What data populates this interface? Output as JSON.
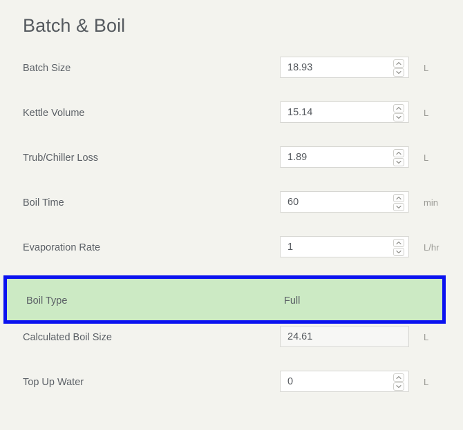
{
  "header": {
    "title": "Batch & Boil"
  },
  "form": {
    "rows": [
      {
        "label": "Batch Size",
        "value": "18.93",
        "unit": "L",
        "type": "spinner",
        "name": "batch-size"
      },
      {
        "label": "Kettle Volume",
        "value": "15.14",
        "unit": "L",
        "type": "spinner",
        "name": "kettle-volume"
      },
      {
        "label": "Trub/Chiller Loss",
        "value": "1.89",
        "unit": "L",
        "type": "spinner",
        "name": "trub-chiller-loss"
      },
      {
        "label": "Boil Time",
        "value": "60",
        "unit": "min",
        "type": "spinner",
        "name": "boil-time"
      },
      {
        "label": "Evaporation Rate",
        "value": "1",
        "unit": "L/hr",
        "type": "spinner",
        "name": "evaporation-rate"
      },
      {
        "label": "Boil Type",
        "value": "Full",
        "unit": "",
        "type": "static",
        "name": "boil-type",
        "highlighted": true
      },
      {
        "label": "Calculated Boil Size",
        "value": "24.61",
        "unit": "L",
        "type": "readonly",
        "name": "calculated-boil-size"
      },
      {
        "label": "Top Up Water",
        "value": "0",
        "unit": "L",
        "type": "spinner",
        "name": "top-up-water"
      }
    ]
  },
  "icons": {
    "spinner_up": "chevron-up-icon",
    "spinner_down": "chevron-down-icon"
  },
  "colors": {
    "page_background": "#f3f3ee",
    "highlight_border": "#0a12f0",
    "highlight_fill": "#cceac4",
    "label_text": "#5b6066",
    "unit_text": "#9a9a95",
    "input_border": "#d6d6d2",
    "input_background": "#ffffff",
    "readonly_background": "#f7f7f5"
  }
}
